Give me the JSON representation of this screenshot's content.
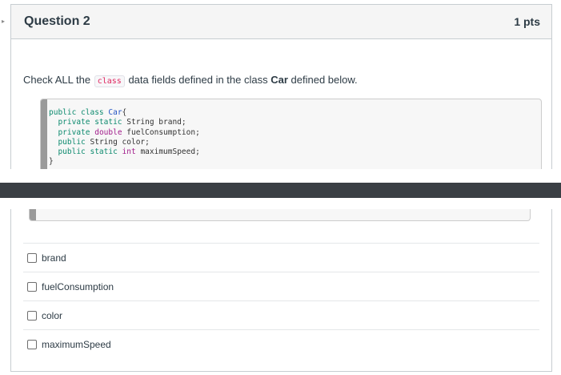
{
  "question": {
    "title": "Question 2",
    "points": "1 pts",
    "prompt_before": "Check ALL the",
    "prompt_code": "class",
    "prompt_middle": "data fields defined in the class",
    "prompt_class": "Car",
    "prompt_after": "defined below."
  },
  "code": {
    "line1_kw": "public class",
    "line1_name": "Car",
    "line1_brace": "{",
    "line2_kw": "private static",
    "line2_rest": "String brand;",
    "line3_kw": "private",
    "line3_type": "double",
    "line3_rest": "fuelConsumption;",
    "line4_kw": "public",
    "line4_rest": "String color;",
    "line5_kw": "public static",
    "line5_type": "int",
    "line5_rest": "maximumSpeed;",
    "closing": "}"
  },
  "answers": [
    {
      "label": "brand",
      "checked": false
    },
    {
      "label": "fuelConsumption",
      "checked": false
    },
    {
      "label": "color",
      "checked": false
    },
    {
      "label": "maximumSpeed",
      "checked": false
    }
  ],
  "colors": {
    "header_bg": "#f5f5f5",
    "separator": "#3a3f44",
    "inline_code": "#e0245e",
    "keyword": "#0c8a6e",
    "type": "#a11b8a",
    "classname": "#2455c3"
  }
}
